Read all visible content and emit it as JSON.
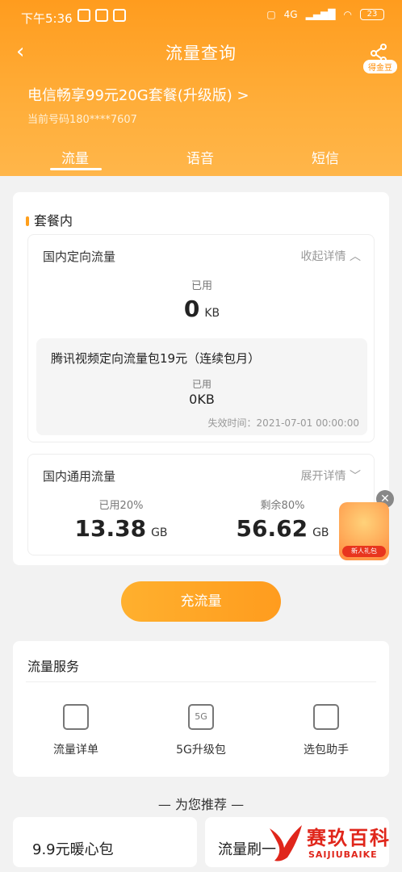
{
  "status_bar": {
    "time": "下午5:36",
    "battery": "23",
    "network": "4G"
  },
  "nav": {
    "title": "流量查询",
    "badge": "得金豆"
  },
  "plan": {
    "name": "电信畅享99元20G套餐(升级版) >",
    "phone": "当前号码180****7607"
  },
  "tabs": [
    {
      "label": "流量"
    },
    {
      "label": "语音"
    },
    {
      "label": "短信"
    }
  ],
  "section": {
    "title": "套餐内"
  },
  "directional": {
    "title": "国内定向流量",
    "toggle": "收起详情",
    "used_label": "已用",
    "used_value": "0",
    "used_unit": "KB",
    "pack": {
      "name": "腾讯视频定向流量包19元（连续包月）",
      "used_label": "已用",
      "used_value": "0KB",
      "expiry": "失效时间：2021-07-01 00:00:00"
    }
  },
  "general": {
    "title": "国内通用流量",
    "toggle": "展开详情",
    "used_label": "已用20%",
    "used_value": "13.38",
    "used_unit": "GB",
    "remain_label": "剩余80%",
    "remain_value": "56.62",
    "remain_unit": "GB"
  },
  "gift": {
    "label": "新人礼包"
  },
  "recharge_button": "充流量",
  "services": {
    "title": "流量服务",
    "items": [
      {
        "label": "流量详单",
        "icon": "detail-list-icon"
      },
      {
        "label": "5G升级包",
        "icon": "5g-gift-icon"
      },
      {
        "label": "选包助手",
        "icon": "package-assistant-icon"
      }
    ]
  },
  "recommend": {
    "title": "— 为您推荐 —",
    "cards": [
      {
        "label": "9.9元暖心包"
      },
      {
        "label": "流量刷一"
      }
    ]
  },
  "watermark": {
    "cn": "赛玖百科",
    "en": "SAIJIUBAIKE"
  },
  "colors": {
    "accent": "#ff9c1e",
    "button": "#ffa726"
  }
}
